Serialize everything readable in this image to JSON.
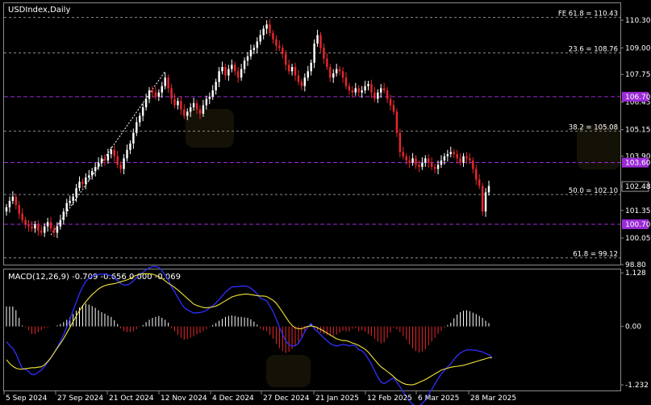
{
  "chart_data": [
    {
      "type": "candlestick",
      "title": "USDIndex,Daily",
      "ylim": [
        98.8,
        111.1
      ],
      "y_ticks": [
        "110.30",
        "109.00",
        "107.75",
        "106.45",
        "105.15",
        "103.90",
        "102.48",
        "101.35",
        "100.05",
        "98.80"
      ],
      "x_tick_labels": [
        "5 Sep 2024",
        "27 Sep 2024",
        "21 Oct 2024",
        "12 Nov 2024",
        "4 Dec 2024",
        "27 Dec 2024",
        "21 Jan 2025",
        "12 Feb 2025",
        "6 Mar 2025",
        "28 Mar 2025"
      ],
      "current_price": "102.48",
      "price_tags": [
        {
          "label": "106.70",
          "value": 106.7,
          "color": "#9a2bd6"
        },
        {
          "label": "103.60",
          "value": 103.6,
          "color": "#9a2bd6"
        },
        {
          "label": "100.70",
          "value": 100.7,
          "color": "#9a2bd6"
        }
      ],
      "horizontal_lines": [
        {
          "value": 106.7,
          "style": "purple-dashed"
        },
        {
          "value": 103.6,
          "style": "purple-dashed"
        },
        {
          "value": 100.7,
          "style": "purple-dashed"
        }
      ],
      "fibonacci_levels": [
        {
          "label": "FE 61.8 = 110.43",
          "value": 110.43
        },
        {
          "label": "23.6 = 108.76",
          "value": 108.76
        },
        {
          "label": "38.2 = 105.08",
          "value": 105.08
        },
        {
          "label": "50.0 = 102.10",
          "value": 102.1
        },
        {
          "label": "61.8 = 99.12",
          "value": 99.12
        }
      ],
      "trendline": [
        {
          "date": "27 Sep 2024",
          "value": 100.2
        },
        {
          "date": "12 Nov 2024",
          "value": 107.9
        }
      ],
      "closes": [
        101.5,
        101.8,
        102.0,
        101.6,
        101.2,
        100.9,
        100.7,
        100.6,
        100.5,
        100.7,
        100.4,
        100.3,
        100.6,
        100.8,
        100.5,
        100.3,
        100.6,
        100.9,
        101.3,
        101.7,
        101.8,
        102.0,
        102.4,
        102.7,
        102.6,
        102.9,
        103.0,
        103.2,
        103.4,
        103.6,
        103.8,
        103.7,
        104.0,
        104.2,
        103.9,
        103.5,
        103.3,
        103.8,
        104.2,
        104.5,
        105.0,
        105.5,
        105.8,
        106.2,
        106.6,
        107.0,
        106.9,
        106.7,
        106.9,
        107.2,
        107.6,
        107.1,
        106.6,
        106.3,
        106.5,
        106.1,
        105.8,
        106.0,
        106.2,
        106.4,
        106.1,
        105.9,
        106.3,
        106.6,
        106.7,
        107.0,
        107.4,
        107.9,
        108.1,
        107.7,
        108.0,
        108.2,
        107.9,
        107.6,
        108.0,
        108.4,
        108.6,
        108.9,
        109.0,
        109.3,
        109.6,
        109.9,
        110.1,
        109.7,
        109.4,
        109.1,
        109.0,
        108.7,
        108.2,
        107.9,
        108.1,
        107.7,
        107.4,
        107.2,
        107.6,
        107.9,
        108.3,
        109.2,
        109.6,
        109.0,
        108.5,
        108.1,
        107.6,
        107.8,
        108.0,
        107.9,
        107.6,
        107.2,
        107.0,
        106.9,
        107.1,
        106.9,
        107.0,
        107.2,
        107.3,
        106.9,
        106.6,
        106.9,
        107.1,
        107.0,
        106.6,
        106.3,
        106.0,
        105.0,
        104.1,
        103.9,
        103.7,
        103.6,
        103.8,
        103.5,
        103.4,
        103.6,
        103.8,
        103.6,
        103.4,
        103.3,
        103.5,
        103.7,
        103.9,
        104.0,
        104.1,
        104.0,
        103.8,
        103.6,
        103.9,
        103.8,
        103.7,
        103.3,
        102.8,
        102.5,
        101.3,
        102.2,
        102.5
      ],
      "macd": {
        "label": "MACD(12,26,9) -0.709 -0.656 0.000 -0.069",
        "ylim": [
          -1.35,
          1.2
        ],
        "y_ticks": [
          "1.128",
          "0.00",
          "-1.232"
        ],
        "histogram": [
          0.42,
          0.42,
          0.42,
          0.34,
          0.18,
          0.02,
          -0.02,
          -0.08,
          -0.16,
          -0.16,
          -0.12,
          -0.08,
          -0.04,
          -0.02,
          0.0,
          0.0,
          0.02,
          0.05,
          0.09,
          0.14,
          0.19,
          0.26,
          0.33,
          0.4,
          0.45,
          0.48,
          0.46,
          0.43,
          0.39,
          0.34,
          0.3,
          0.27,
          0.23,
          0.2,
          0.13,
          0.05,
          -0.04,
          -0.1,
          -0.12,
          -0.12,
          -0.1,
          -0.06,
          -0.01,
          0.03,
          0.09,
          0.14,
          0.18,
          0.2,
          0.22,
          0.18,
          0.14,
          0.08,
          -0.04,
          -0.1,
          -0.18,
          -0.24,
          -0.28,
          -0.27,
          -0.24,
          -0.21,
          -0.17,
          -0.14,
          -0.1,
          -0.06,
          -0.01,
          0.03,
          0.07,
          0.12,
          0.16,
          0.2,
          0.22,
          0.23,
          0.22,
          0.2,
          0.2,
          0.19,
          0.18,
          0.15,
          0.1,
          0.04,
          -0.05,
          -0.08,
          -0.1,
          -0.18,
          -0.26,
          -0.37,
          -0.46,
          -0.52,
          -0.56,
          -0.54,
          -0.48,
          -0.42,
          -0.34,
          -0.22,
          -0.1,
          -0.01,
          0.06,
          -0.06,
          -0.08,
          -0.13,
          -0.16,
          -0.18,
          -0.2,
          -0.19,
          -0.17,
          -0.13,
          -0.09,
          -0.1,
          -0.1,
          -0.05,
          -0.04,
          -0.1,
          -0.08,
          -0.11,
          -0.16,
          -0.2,
          -0.26,
          -0.32,
          -0.36,
          -0.34,
          -0.24,
          -0.13,
          -0.03,
          -0.06,
          -0.12,
          -0.2,
          -0.28,
          -0.38,
          -0.46,
          -0.52,
          -0.55,
          -0.53,
          -0.48,
          -0.4,
          -0.32,
          -0.24,
          -0.16,
          -0.09,
          -0.03,
          0.03,
          0.08,
          0.17,
          0.25,
          0.3,
          0.33,
          0.34,
          0.32,
          0.29,
          0.26,
          0.22,
          0.18,
          0.12,
          0.07
        ],
        "signal": [
          -0.7,
          -0.78,
          -0.84,
          -0.88,
          -0.9,
          -0.9,
          -0.89,
          -0.88,
          -0.87,
          -0.87,
          -0.86,
          -0.85,
          -0.81,
          -0.74,
          -0.66,
          -0.56,
          -0.46,
          -0.36,
          -0.26,
          -0.14,
          -0.02,
          0.1,
          0.22,
          0.33,
          0.43,
          0.52,
          0.6,
          0.67,
          0.73,
          0.79,
          0.83,
          0.86,
          0.88,
          0.89,
          0.9,
          0.92,
          0.94,
          0.96,
          0.98,
          1.01,
          1.05,
          1.08,
          1.1,
          1.11,
          1.11,
          1.11,
          1.1,
          1.08,
          1.05,
          1.01,
          0.96,
          0.91,
          0.87,
          0.82,
          0.77,
          0.71,
          0.65,
          0.59,
          0.53,
          0.47,
          0.44,
          0.42,
          0.4,
          0.39,
          0.4,
          0.41,
          0.43,
          0.46,
          0.5,
          0.54,
          0.58,
          0.62,
          0.64,
          0.66,
          0.67,
          0.68,
          0.68,
          0.67,
          0.66,
          0.65,
          0.64,
          0.64,
          0.63,
          0.59,
          0.55,
          0.49,
          0.4,
          0.3,
          0.2,
          0.1,
          0.02,
          -0.03,
          -0.05,
          -0.05,
          -0.02,
          0.0,
          0.01,
          0.0,
          -0.03,
          -0.06,
          -0.1,
          -0.14,
          -0.18,
          -0.22,
          -0.26,
          -0.28,
          -0.3,
          -0.3,
          -0.32,
          -0.35,
          -0.37,
          -0.4,
          -0.44,
          -0.48,
          -0.54,
          -0.62,
          -0.7,
          -0.78,
          -0.85,
          -0.9,
          -0.95,
          -1.0,
          -1.06,
          -1.12,
          -1.16,
          -1.2,
          -1.22,
          -1.23,
          -1.23,
          -1.21,
          -1.18,
          -1.15,
          -1.12,
          -1.08,
          -1.04,
          -1.0,
          -0.96,
          -0.92,
          -0.9,
          -0.88,
          -0.86,
          -0.85,
          -0.84,
          -0.83,
          -0.82,
          -0.8,
          -0.78,
          -0.76,
          -0.74,
          -0.72,
          -0.7,
          -0.68,
          -0.66,
          -0.656
        ]
      }
    }
  ],
  "colors": {
    "background": "#000000",
    "bull": "#ffffff",
    "bear": "#e8272d",
    "grid": "#8a8a8a",
    "level": "#9a2bd6",
    "macd_main": "#2f2fff",
    "macd_signal": "#f2e33a"
  }
}
